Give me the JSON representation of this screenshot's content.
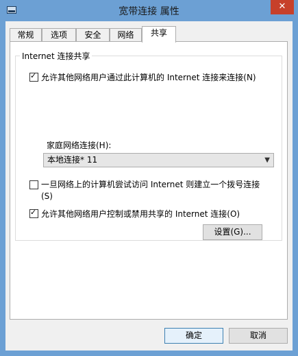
{
  "window": {
    "title": "宽带连接 属性",
    "close_label": "✕"
  },
  "tabs": [
    {
      "label": "常规"
    },
    {
      "label": "选项"
    },
    {
      "label": "安全"
    },
    {
      "label": "网络"
    },
    {
      "label": "共享"
    }
  ],
  "active_tab": "共享",
  "group": {
    "legend": "Internet 连接共享",
    "allow_share": {
      "label": "允许其他网络用户通过此计算机的 Internet 连接来连接(N)",
      "checked": true
    },
    "home_network": {
      "label": "家庭网络连接(H):",
      "value": "本地连接* 11"
    },
    "dial_on_demand": {
      "label": "一旦网络上的计算机尝试访问 Internet 则建立一个拨号连接(S)",
      "checked": false
    },
    "allow_control": {
      "label": "允许其他网络用户控制或禁用共享的 Internet 连接(O)",
      "checked": true
    },
    "settings_button": "设置(G)..."
  },
  "buttons": {
    "ok": "确定",
    "cancel": "取消"
  }
}
